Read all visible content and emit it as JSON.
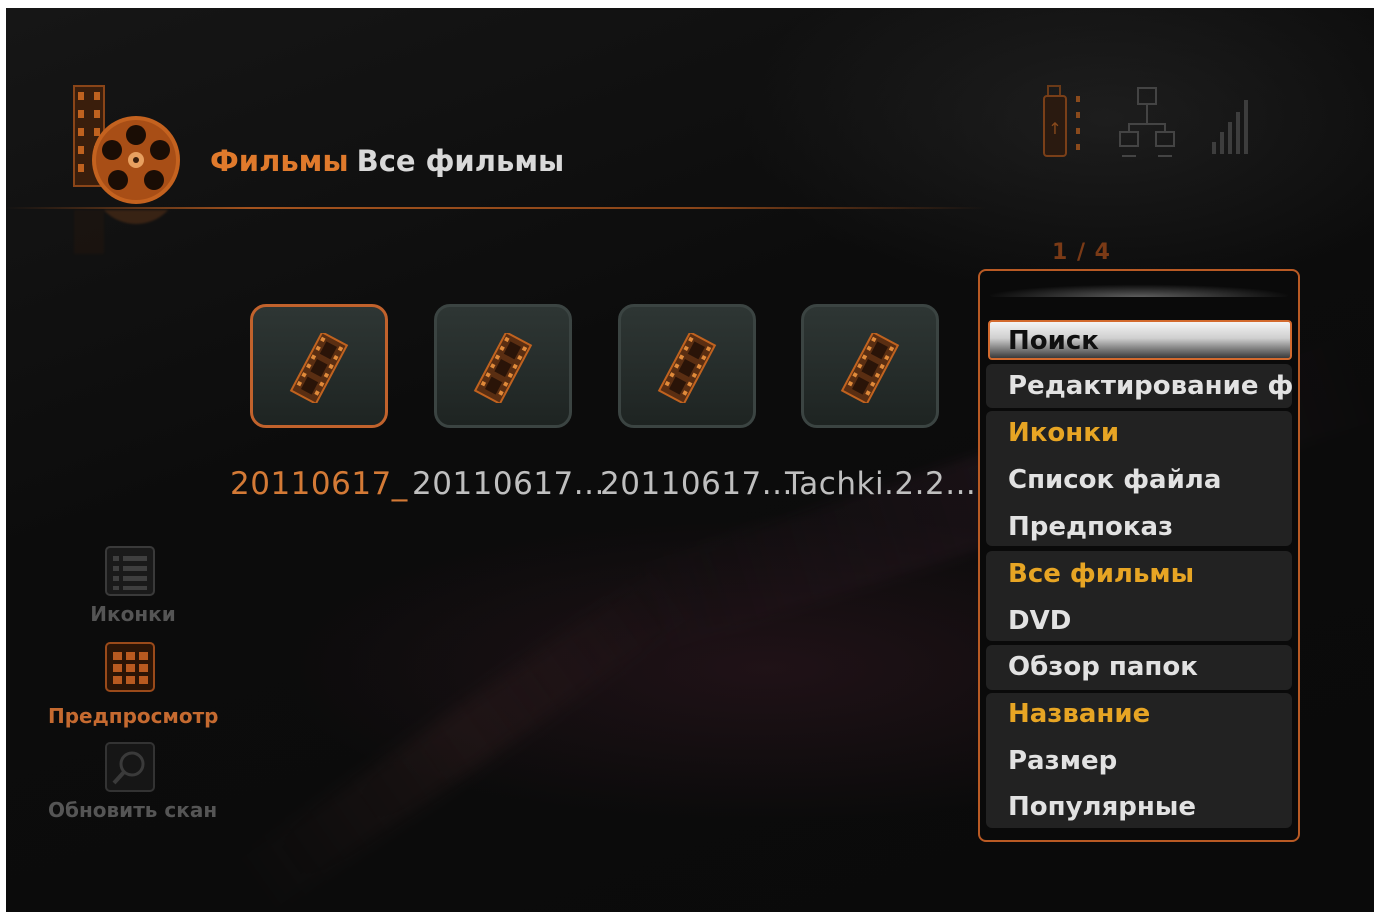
{
  "header": {
    "section": "Фильмы",
    "subsection": "Все фильмы"
  },
  "status_icons": [
    "usb-drive-icon",
    "network-icon",
    "signal-strength-icon"
  ],
  "page_indicator": "1 / 4",
  "thumbnails": [
    {
      "label": "20110617_",
      "selected": true
    },
    {
      "label": "20110617...",
      "selected": false
    },
    {
      "label": "20110617...",
      "selected": false
    },
    {
      "label": "Tachki.2.2...",
      "selected": false
    }
  ],
  "view_modes": [
    {
      "label": "Иконки",
      "icon": "list-view-icon",
      "selected": false
    },
    {
      "label": "Предпросмотр",
      "icon": "grid-view-icon",
      "selected": true
    },
    {
      "label": "Обновить сканирование",
      "icon": "scan-icon",
      "selected": false
    }
  ],
  "menu": {
    "items": [
      {
        "label": "Поиск",
        "type": "highlight"
      },
      {
        "label": "Редактирование ф",
        "type": "item"
      },
      {
        "label": "Иконки",
        "type": "head"
      },
      {
        "label": "Список файла",
        "type": "item"
      },
      {
        "label": "Предпоказ",
        "type": "item"
      },
      {
        "label": "Все фильмы",
        "type": "head"
      },
      {
        "label": "DVD",
        "type": "item"
      },
      {
        "label": "Обзор папок",
        "type": "item"
      },
      {
        "label": "Название",
        "type": "head"
      },
      {
        "label": "Размер",
        "type": "item"
      },
      {
        "label": "Популярные",
        "type": "item"
      }
    ]
  },
  "colors": {
    "accent_orange": "#e07a2c",
    "menu_header_yellow": "#e7a524",
    "background": "#0c0c0c"
  }
}
